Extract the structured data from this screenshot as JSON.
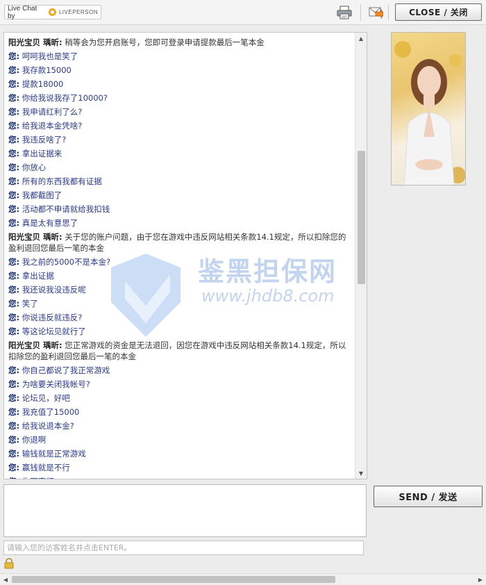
{
  "header": {
    "live_chat_label": "Live Chat by",
    "provider_name": "LIVEPERSON",
    "print_icon": "printer-icon",
    "email_icon": "email-transcript-icon",
    "close_label": "CLOSE / 关闭"
  },
  "transcript": {
    "messages": [
      {
        "who": "阳光宝贝 瑀昕:",
        "text": " 稍等会为您开启账号，您即可登录申请提款最后一笔本金",
        "role": "agent"
      },
      {
        "who": "您:",
        "text": " 呵呵我也是笑了",
        "role": "visitor"
      },
      {
        "who": "您:",
        "text": " 我存款15000",
        "role": "visitor"
      },
      {
        "who": "您:",
        "text": " 提款18000",
        "role": "visitor"
      },
      {
        "who": "您:",
        "text": " 你给我说我存了10000?",
        "role": "visitor"
      },
      {
        "who": "您:",
        "text": " 我申请红利了么?",
        "role": "visitor"
      },
      {
        "who": "您:",
        "text": " 给我退本金凭啥?",
        "role": "visitor"
      },
      {
        "who": "您:",
        "text": " 我违反啥了?",
        "role": "visitor"
      },
      {
        "who": "您:",
        "text": " 拿出证据来",
        "role": "visitor"
      },
      {
        "who": "您:",
        "text": " 你放心",
        "role": "visitor"
      },
      {
        "who": "您:",
        "text": " 所有的东西我都有证据",
        "role": "visitor"
      },
      {
        "who": "您:",
        "text": " 我都截图了",
        "role": "visitor"
      },
      {
        "who": "您:",
        "text": " 活动都不申请就给我扣钱",
        "role": "visitor"
      },
      {
        "who": "您:",
        "text": " 真是太有意思了",
        "role": "visitor"
      },
      {
        "who": "阳光宝贝 瑀昕:",
        "text": " 关于您的账户问题，由于您在游戏中违反网站相关条款14.1规定，所以扣除您的盈利退回您最后一笔的本金",
        "role": "agent"
      },
      {
        "who": "您:",
        "text": " 我之前的5000不是本金?",
        "role": "visitor"
      },
      {
        "who": "您:",
        "text": " 拿出证据",
        "role": "visitor"
      },
      {
        "who": "您:",
        "text": " 我还说我没违反呢",
        "role": "visitor"
      },
      {
        "who": "您:",
        "text": " 笑了",
        "role": "visitor"
      },
      {
        "who": "您:",
        "text": " 你说违反就违反?",
        "role": "visitor"
      },
      {
        "who": "您:",
        "text": " 等这论坛见就行了",
        "role": "visitor"
      },
      {
        "who": "阳光宝贝 瑀昕:",
        "text": " 您正常游戏的资金是无法退回，因您在游戏中违反网站相关条款14.1规定，所以扣除您的盈利退回您最后一笔的本金",
        "role": "agent"
      },
      {
        "who": "您:",
        "text": " 你自己都说了我正常游戏",
        "role": "visitor"
      },
      {
        "who": "您:",
        "text": " 为啥要关闭我帐号?",
        "role": "visitor"
      },
      {
        "who": "您:",
        "text": " 论坛见，好吧",
        "role": "visitor"
      },
      {
        "who": "您:",
        "text": " 我充值了15000",
        "role": "visitor"
      },
      {
        "who": "您:",
        "text": " 给我说退本金?",
        "role": "visitor"
      },
      {
        "who": "您:",
        "text": " 你退啊",
        "role": "visitor"
      },
      {
        "who": "您:",
        "text": " 输钱就是正常游戏",
        "role": "visitor"
      },
      {
        "who": "您:",
        "text": " 赢钱就是不行",
        "role": "visitor"
      },
      {
        "who": "您:",
        "text": " 你可真行",
        "role": "visitor"
      }
    ]
  },
  "watermark": {
    "title": "鉴黑担保网",
    "url": "www.jhdb8.com"
  },
  "compose": {
    "message_value": "",
    "name_placeholder": "请输入您的访客姓名并点击ENTER。",
    "send_label": "SEND / 发送",
    "lock_icon": "lock-icon"
  },
  "colors": {
    "visitor_text": "#2a3a8a",
    "agent_text": "#333333",
    "accent_orange": "#f5a623"
  }
}
